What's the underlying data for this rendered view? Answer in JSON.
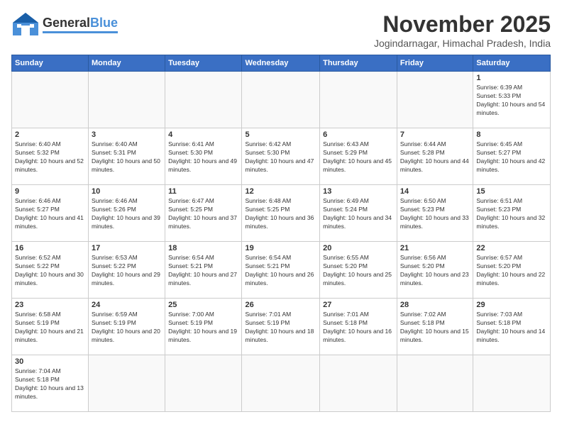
{
  "header": {
    "logo_general": "General",
    "logo_blue": "Blue",
    "month": "November 2025",
    "location": "Jogindarnagar, Himachal Pradesh, India"
  },
  "weekdays": [
    "Sunday",
    "Monday",
    "Tuesday",
    "Wednesday",
    "Thursday",
    "Friday",
    "Saturday"
  ],
  "weeks": [
    [
      {
        "day": "",
        "detail": ""
      },
      {
        "day": "",
        "detail": ""
      },
      {
        "day": "",
        "detail": ""
      },
      {
        "day": "",
        "detail": ""
      },
      {
        "day": "",
        "detail": ""
      },
      {
        "day": "",
        "detail": ""
      },
      {
        "day": "1",
        "detail": "Sunrise: 6:39 AM\nSunset: 5:33 PM\nDaylight: 10 hours and 54 minutes."
      }
    ],
    [
      {
        "day": "2",
        "detail": "Sunrise: 6:40 AM\nSunset: 5:32 PM\nDaylight: 10 hours and 52 minutes."
      },
      {
        "day": "3",
        "detail": "Sunrise: 6:40 AM\nSunset: 5:31 PM\nDaylight: 10 hours and 50 minutes."
      },
      {
        "day": "4",
        "detail": "Sunrise: 6:41 AM\nSunset: 5:30 PM\nDaylight: 10 hours and 49 minutes."
      },
      {
        "day": "5",
        "detail": "Sunrise: 6:42 AM\nSunset: 5:30 PM\nDaylight: 10 hours and 47 minutes."
      },
      {
        "day": "6",
        "detail": "Sunrise: 6:43 AM\nSunset: 5:29 PM\nDaylight: 10 hours and 45 minutes."
      },
      {
        "day": "7",
        "detail": "Sunrise: 6:44 AM\nSunset: 5:28 PM\nDaylight: 10 hours and 44 minutes."
      },
      {
        "day": "8",
        "detail": "Sunrise: 6:45 AM\nSunset: 5:27 PM\nDaylight: 10 hours and 42 minutes."
      }
    ],
    [
      {
        "day": "9",
        "detail": "Sunrise: 6:46 AM\nSunset: 5:27 PM\nDaylight: 10 hours and 41 minutes."
      },
      {
        "day": "10",
        "detail": "Sunrise: 6:46 AM\nSunset: 5:26 PM\nDaylight: 10 hours and 39 minutes."
      },
      {
        "day": "11",
        "detail": "Sunrise: 6:47 AM\nSunset: 5:25 PM\nDaylight: 10 hours and 37 minutes."
      },
      {
        "day": "12",
        "detail": "Sunrise: 6:48 AM\nSunset: 5:25 PM\nDaylight: 10 hours and 36 minutes."
      },
      {
        "day": "13",
        "detail": "Sunrise: 6:49 AM\nSunset: 5:24 PM\nDaylight: 10 hours and 34 minutes."
      },
      {
        "day": "14",
        "detail": "Sunrise: 6:50 AM\nSunset: 5:23 PM\nDaylight: 10 hours and 33 minutes."
      },
      {
        "day": "15",
        "detail": "Sunrise: 6:51 AM\nSunset: 5:23 PM\nDaylight: 10 hours and 32 minutes."
      }
    ],
    [
      {
        "day": "16",
        "detail": "Sunrise: 6:52 AM\nSunset: 5:22 PM\nDaylight: 10 hours and 30 minutes."
      },
      {
        "day": "17",
        "detail": "Sunrise: 6:53 AM\nSunset: 5:22 PM\nDaylight: 10 hours and 29 minutes."
      },
      {
        "day": "18",
        "detail": "Sunrise: 6:54 AM\nSunset: 5:21 PM\nDaylight: 10 hours and 27 minutes."
      },
      {
        "day": "19",
        "detail": "Sunrise: 6:54 AM\nSunset: 5:21 PM\nDaylight: 10 hours and 26 minutes."
      },
      {
        "day": "20",
        "detail": "Sunrise: 6:55 AM\nSunset: 5:20 PM\nDaylight: 10 hours and 25 minutes."
      },
      {
        "day": "21",
        "detail": "Sunrise: 6:56 AM\nSunset: 5:20 PM\nDaylight: 10 hours and 23 minutes."
      },
      {
        "day": "22",
        "detail": "Sunrise: 6:57 AM\nSunset: 5:20 PM\nDaylight: 10 hours and 22 minutes."
      }
    ],
    [
      {
        "day": "23",
        "detail": "Sunrise: 6:58 AM\nSunset: 5:19 PM\nDaylight: 10 hours and 21 minutes."
      },
      {
        "day": "24",
        "detail": "Sunrise: 6:59 AM\nSunset: 5:19 PM\nDaylight: 10 hours and 20 minutes."
      },
      {
        "day": "25",
        "detail": "Sunrise: 7:00 AM\nSunset: 5:19 PM\nDaylight: 10 hours and 19 minutes."
      },
      {
        "day": "26",
        "detail": "Sunrise: 7:01 AM\nSunset: 5:19 PM\nDaylight: 10 hours and 18 minutes."
      },
      {
        "day": "27",
        "detail": "Sunrise: 7:01 AM\nSunset: 5:18 PM\nDaylight: 10 hours and 16 minutes."
      },
      {
        "day": "28",
        "detail": "Sunrise: 7:02 AM\nSunset: 5:18 PM\nDaylight: 10 hours and 15 minutes."
      },
      {
        "day": "29",
        "detail": "Sunrise: 7:03 AM\nSunset: 5:18 PM\nDaylight: 10 hours and 14 minutes."
      }
    ],
    [
      {
        "day": "30",
        "detail": "Sunrise: 7:04 AM\nSunset: 5:18 PM\nDaylight: 10 hours and 13 minutes."
      },
      {
        "day": "",
        "detail": ""
      },
      {
        "day": "",
        "detail": ""
      },
      {
        "day": "",
        "detail": ""
      },
      {
        "day": "",
        "detail": ""
      },
      {
        "day": "",
        "detail": ""
      },
      {
        "day": "",
        "detail": ""
      }
    ]
  ]
}
